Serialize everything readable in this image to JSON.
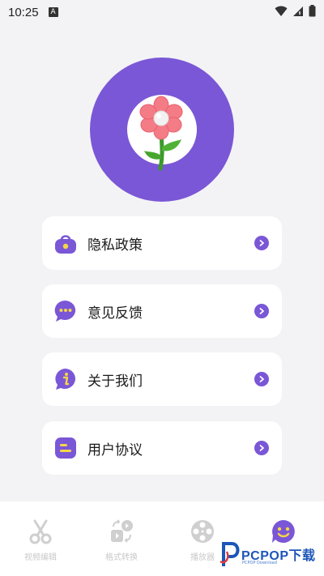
{
  "status_bar": {
    "time": "10:25",
    "notification_icon_letter": "A",
    "icons": [
      "wifi-icon",
      "signal-icon",
      "battery-icon"
    ]
  },
  "avatar": {
    "icon": "flower-icon",
    "ring_color": "#7a57d6"
  },
  "menu": {
    "items": [
      {
        "label": "隐私政策",
        "icon": "lock-bag-icon"
      },
      {
        "label": "意见反馈",
        "icon": "chat-bubble-icon"
      },
      {
        "label": "关于我们",
        "icon": "info-icon"
      },
      {
        "label": "用户协议",
        "icon": "document-icon"
      }
    ],
    "accent_color": "#7a57d6"
  },
  "bottom_nav": {
    "items": [
      {
        "label": "视频编辑",
        "icon": "scissors-icon",
        "active": false
      },
      {
        "label": "格式转换",
        "icon": "convert-icon",
        "active": false
      },
      {
        "label": "播放器",
        "icon": "film-reel-icon",
        "active": false
      },
      {
        "label": "",
        "icon": "smiley-icon",
        "active": true
      }
    ]
  },
  "watermark": {
    "text": "PCPOP下载",
    "subtext": "PCPOP Download"
  }
}
